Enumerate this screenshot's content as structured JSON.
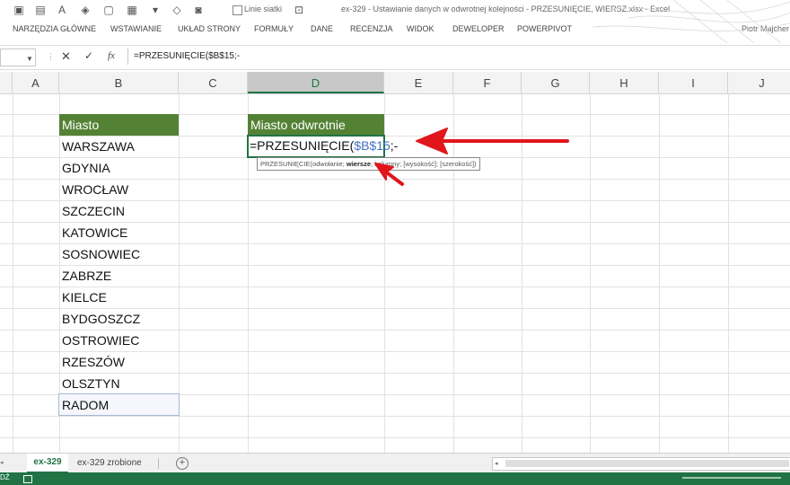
{
  "window": {
    "title": "ex-329 - Ustawianie danych w odwrotnej kolejności - PRZESUNIĘCIE, WIERSZ.xlsx - Excel",
    "user": "Piotr Majcher",
    "gridlines_label": "Linie siatki"
  },
  "ribbon": {
    "tabs": [
      "NARZĘDZIA GŁÓWNE",
      "WSTAWIANIE",
      "UKŁAD STRONY",
      "FORMUŁY",
      "DANE",
      "RECENZJA",
      "WIDOK",
      "DEWELOPER",
      "POWERPIVOT"
    ]
  },
  "formula_bar": {
    "name_box": "",
    "cancel": "✕",
    "enter": "✓",
    "fx": "fx",
    "formula": "=PRZESUNIĘCIE($B$15;-"
  },
  "columns": [
    "A",
    "B",
    "C",
    "D",
    "E",
    "F",
    "G",
    "H",
    "I",
    "J"
  ],
  "selected_column": "D",
  "table": {
    "header_b": "Miasto",
    "header_d": "Miasto odwrotnie",
    "cities": [
      "WARSZAWA",
      "GDYNIA",
      "WROCŁAW",
      "SZCZECIN",
      "KATOWICE",
      "SOSNOWIEC",
      "ZABRZE",
      "KIELCE",
      "BYDGOSZCZ",
      "OSTROWIEC",
      "RZESZÓW",
      "OLSZTYN",
      "RADOM"
    ]
  },
  "editing_cell": {
    "prefix": "=PRZESUNIĘCIE(",
    "ref": "$B$15",
    "suffix": ";-"
  },
  "tooltip": {
    "func": "PRZESUNIĘCIE(",
    "arg1": "odwołanie; ",
    "arg2_bold": "wiersze",
    "rest": "; kolumny; [wysokość]; [szerokość])"
  },
  "sheet_tabs": {
    "active": "ex-329",
    "other": "ex-329 zrobione",
    "add": "+"
  },
  "status": {
    "mode": "DŹ"
  },
  "colors": {
    "header_green": "#548235",
    "excel_green": "#217346",
    "annotation_red": "#e0161c",
    "ref_blue": "#4472c4"
  }
}
